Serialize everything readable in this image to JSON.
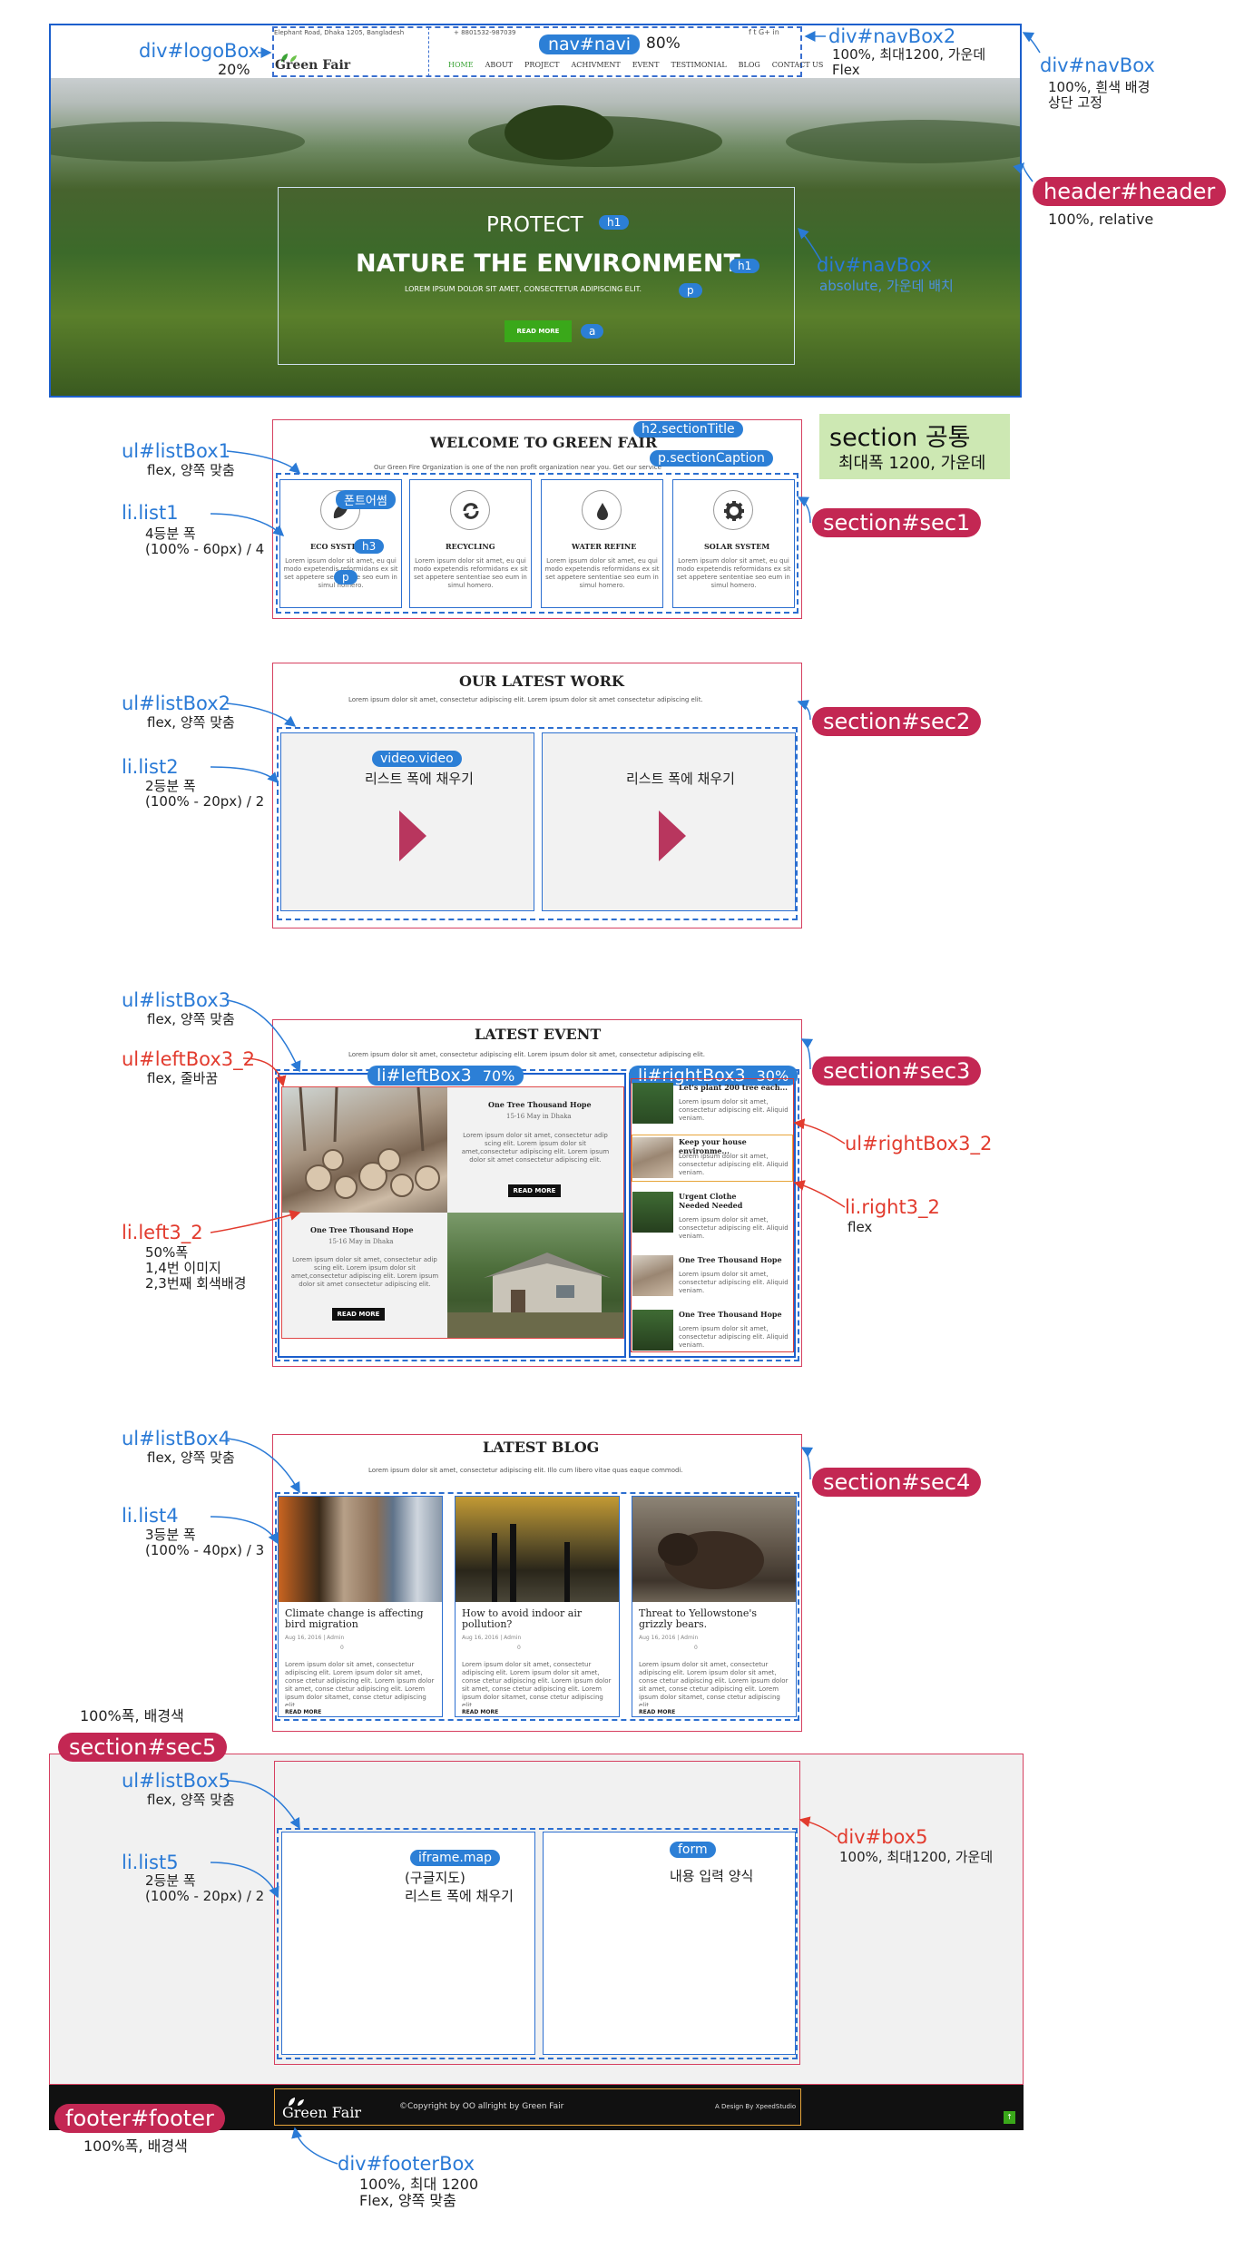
{
  "header": {
    "address": "Elephant Road, Dhaka 1205, Bangladesh",
    "phone": "+ 8801532-987039",
    "social": "f  t  G+  in",
    "logo_text": "Green Fair",
    "menu": [
      "HOME",
      "ABOUT",
      "PROJECT",
      "ACHIVMENT",
      "EVENT",
      "TESTIMONIAL",
      "BLOG",
      "CONTACT US"
    ],
    "hero_line1": "PROTECT",
    "hero_line2": "NATURE THE ENVIRONMENT",
    "hero_caption": "LOREM IPSUM DOLOR SIT AMET, CONSECTETUR ADIPISCING ELIT.",
    "hero_button": "READ MORE"
  },
  "annotations": {
    "logoBox": "div#logoBox",
    "logoBox_w": "20%",
    "navi": "nav#navi",
    "navi_w": "80%",
    "navBox2": "div#navBox2",
    "navBox2_desc": "100%, 최대1200, 가운데\nFlex",
    "navBox": "div#navBox",
    "navBox_desc": "100%, 흰색 배경\n상단 고정",
    "header": "header#header",
    "header_desc": "100%, relative",
    "h1_tag": "h1",
    "p_tag": "p",
    "a_tag": "a",
    "heroNavBox": "div#navBox",
    "heroNavBox_desc": "absolute, 가운데 배치",
    "section_common": "section 공통",
    "section_common_desc": "최대폭 1200, 가운데",
    "listBox1": "ul#listBox1",
    "listBox1_desc": "flex, 양쪽 맞춤",
    "list1": "li.list1",
    "list1_desc": "4등분 폭\n(100% - 60px) / 4",
    "sectionTitle": "h2.sectionTitle",
    "sectionCaption": "p.sectionCaption",
    "fontawesome": "폰트어썸",
    "h3_tag": "h3",
    "sec1": "section#sec1",
    "listBox2": "ul#listBox2",
    "listBox2_desc": "flex, 양쪽 맞춤",
    "list2": "li.list2",
    "list2_desc": "2등분 폭\n(100% - 20px) / 2",
    "video": "video.video",
    "fill_list": "리스트 폭에 채우기",
    "sec2": "section#sec2",
    "listBox3": "ul#listBox3",
    "listBox3_desc": "flex, 양쪽 맞춤",
    "leftBox3_2": "ul#leftBox3_2",
    "leftBox3_2_desc": "flex, 줄바꿈",
    "leftBox3": "li#leftBox3",
    "leftBox3_w": "70%",
    "rightBox3": "li#rightBox3",
    "rightBox3_w": "30%",
    "sec3": "section#sec3",
    "rightBox3_2": "ul#rightBox3_2",
    "left3_2": "li.left3_2",
    "left3_2_desc": "50%폭\n1,4번 이미지\n2,3번째 회색배경",
    "right3_2": "li.right3_2",
    "right3_2_desc": "flex",
    "listBox4": "ul#listBox4",
    "listBox4_desc": "flex, 양쪽 맞춤",
    "list4": "li.list4",
    "list4_desc": "3등분 폭\n(100% - 40px) / 3",
    "sec4": "section#sec4",
    "sec5_desc": "100%폭, 배경색",
    "sec5": "section#sec5",
    "listBox5": "ul#listBox5",
    "listBox5_desc": "flex, 양쪽 맞춤",
    "list5": "li.list5",
    "list5_desc": "2등분 폭\n(100% - 20px) / 2",
    "iframe": "iframe.map",
    "iframe_desc": "(구글지도)\n리스트 폭에 채우기",
    "form": "form",
    "form_desc": "내용 입력 양식",
    "box5": "div#box5",
    "box5_desc": "100%, 최대1200, 가운데",
    "footer": "footer#footer",
    "footer_desc": "100%폭, 배경색",
    "footerBox": "div#footerBox",
    "footerBox_desc": "100%, 최대 1200\nFlex, 양쪽 맞춤"
  },
  "sec1": {
    "title": "WELCOME TO GREEN FAIR",
    "caption": "Our Green Fire Organization is one of the non profit organization near you. Get our service",
    "items": [
      {
        "icon": "leaf-icon",
        "title": "ECO SYSTEM"
      },
      {
        "icon": "recycle-icon",
        "title": "RECYCLING"
      },
      {
        "icon": "water-drop-icon",
        "title": "WATER REFINE"
      },
      {
        "icon": "gear-icon",
        "title": "SOLAR SYSTEM"
      }
    ],
    "lorem": "Lorem ipsum dolor sit amet, eu qui modo expetendis reformidans ex sit set appetere sententiae seo eum in simul homero."
  },
  "sec2": {
    "title": "OUR LATEST WORK",
    "caption": "Lorem ipsum dolor sit amet, consectetur adipiscing elit. Lorem ipsum dolor sit amet consectetur adipiscing elit."
  },
  "sec3": {
    "title": "LATEST EVENT",
    "caption": "Lorem ipsum dolor sit amet, consectetur adipiscing elit. Lorem ipsum dolor sit amet, consectetur adipiscing elit.",
    "event_title": "One Tree Thousand Hope",
    "event_date": "15-16 May in Dhaka",
    "event_text": "Lorem ipsum dolor sit amet, consectetur adip scing elit. Lorem ipsum dolor sit amet,consectetur adipiscing elit. Lorem ipsum dolor sit amet consectetur adipiscing elit.",
    "read_more": "READ MORE",
    "right_items": [
      "Let's plant 200 tree each...",
      "Keep your house environme...",
      "Urgent Clothe Needed Needed",
      "One Tree Thousand Hope",
      "One Tree Thousand Hope"
    ],
    "right_text": "Lorem ipsum dolor sit amet, consectetur adipiscing elit. Aliquid veniam."
  },
  "sec4": {
    "title": "LATEST BLOG",
    "caption": "Lorem ipsum dolor sit amet, consectetur adipiscing elit. Illo cum libero vitae quas eaque commodi.",
    "posts": [
      {
        "title": "Climate change is affecting bird migration"
      },
      {
        "title": "How to avoid indoor air pollution?"
      },
      {
        "title": "Threat to Yellowstone's grizzly bears."
      }
    ],
    "meta": "Aug 16, 2016  |  Admin",
    "comments": "0",
    "text": "Lorem ipsum dolor sit amet, consectetur adipiscing elit. Lorem ipsum dolor sit amet, conse ctetur adipiscing elit. Lorem ipsum dolor sit amet, conse ctetur adipiscing elit. Lorem ipsum dolor sitamet, conse ctetur adipiscing elit.",
    "read_more": "READ MORE"
  },
  "footer": {
    "logo_text": "Green Fair",
    "copyright": "©Copyright by OO allright by Green Fair",
    "design": "A Design By XpeedStudio",
    "top_btn": "↑"
  }
}
